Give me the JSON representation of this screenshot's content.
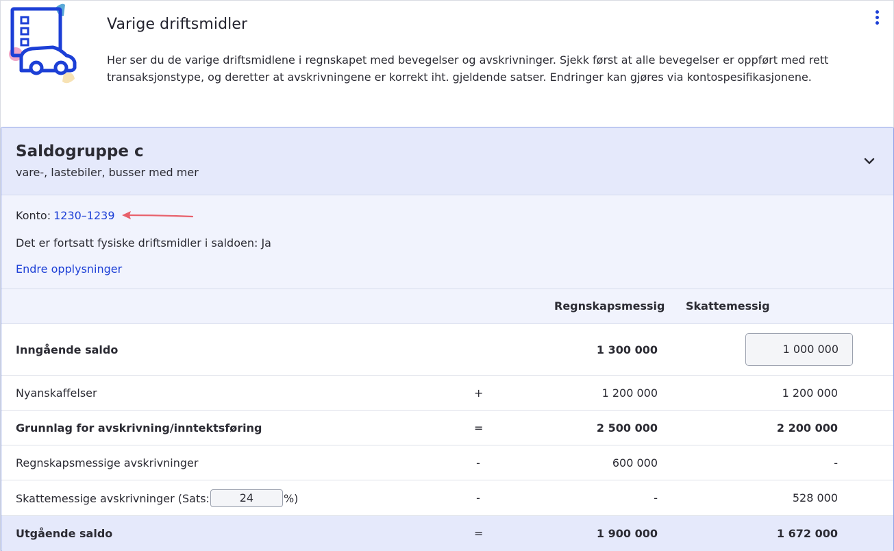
{
  "header": {
    "title": "Varige driftsmidler",
    "description": "Her ser du de varige driftsmidlene i regnskapet med bevegelser og avskrivninger. Sjekk først at alle bevegelser er oppført med rett transaksjonstype, og deretter at avskrivningene er korrekt iht. gjeldende satser. Endringer kan gjøres via kontospesifikasjonene."
  },
  "colors": {
    "accent": "#1c3fd6",
    "card_header": "#e5e9fb",
    "info_bg": "#f1f3fd",
    "arrow": "#e8606b"
  },
  "card": {
    "title": "Saldogruppe c",
    "subtitle": "vare-, lastebiler, busser med mer",
    "konto_label": "Konto:",
    "konto_value": "1230–1239",
    "fysiske": "Det er fortsatt fysiske driftsmidler i saldoen: Ja",
    "endre_link": "Endre opplysninger"
  },
  "table": {
    "col1": "Regnskapsmessig",
    "col2": "Skattemessig",
    "rows": [
      {
        "label": "Inngående saldo",
        "op": "",
        "v1": "1 300 000",
        "v2": "1 000 000"
      },
      {
        "label": "Nyanskaffelser",
        "op": "+",
        "v1": "1 200 000",
        "v2": "1 200 000"
      },
      {
        "label": "Grunnlag for avskrivning/inntektsføring",
        "op": "=",
        "v1": "2 500 000",
        "v2": "2 200 000"
      },
      {
        "label": "Regnskapsmessige avskrivninger",
        "op": "-",
        "v1": "600 000",
        "v2": "-"
      },
      {
        "label": "Skattemessige avskrivninger",
        "op": "-",
        "v1": "-",
        "v2": "528 000"
      },
      {
        "label": "Utgående saldo",
        "op": "=",
        "v1": "1 900 000",
        "v2": "1 672 000"
      }
    ],
    "sats_prefix": "(Sats:",
    "sats_value": "24",
    "sats_suffix": "%)"
  },
  "icons": [
    "asset-logo-icon",
    "kebab-menu-icon",
    "chevron-down-icon",
    "annotation-arrow-icon"
  ]
}
